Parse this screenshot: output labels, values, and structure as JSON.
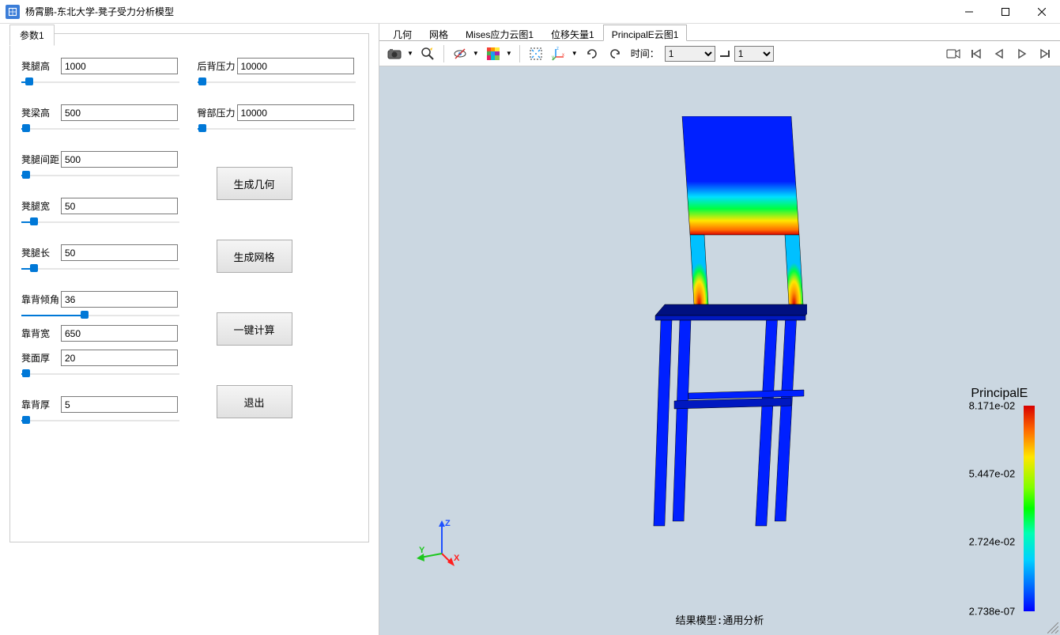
{
  "window": {
    "title": "杨霄鹏-东北大学-凳子受力分析模型"
  },
  "paramsTab": "参数1",
  "params": {
    "leg_height": {
      "label": "凳腿高",
      "value": "1000",
      "pct": 5
    },
    "beam_height": {
      "label": "凳梁高",
      "value": "500",
      "pct": 3
    },
    "leg_spacing": {
      "label": "凳腿间距",
      "value": "500",
      "pct": 3
    },
    "leg_width": {
      "label": "凳腿宽",
      "value": "50",
      "pct": 8
    },
    "leg_length": {
      "label": "凳腿长",
      "value": "50",
      "pct": 8
    },
    "back_angle": {
      "label": "靠背倾角",
      "value": "36",
      "pct": 40
    },
    "back_width": {
      "label": "靠背宽",
      "value": "650",
      "pct": 3
    },
    "seat_thick": {
      "label": "凳面厚",
      "value": "20",
      "pct": 3
    },
    "back_thick": {
      "label": "靠背厚",
      "value": "5",
      "pct": 3
    },
    "back_pressure": {
      "label": "后背压力",
      "value": "10000",
      "pct": 3
    },
    "hip_pressure": {
      "label": "臀部压力",
      "value": "10000",
      "pct": 3
    }
  },
  "buttons": {
    "gen_geom": "生成几何",
    "gen_mesh": "生成网格",
    "compute": "一键计算",
    "exit": "退出"
  },
  "viewTabs": [
    "几何",
    "网格",
    "Mises应力云图1",
    "位移矢量1",
    "PrincipalE云图1"
  ],
  "activeTab": 4,
  "toolbar": {
    "time_label": "时间：",
    "time_value": "1",
    "frame_value": "1"
  },
  "legend": {
    "title": "PrincipalE",
    "values": [
      "8.171e-02",
      "5.447e-02",
      "2.724e-02",
      "2.738e-07"
    ]
  },
  "resultLabel": "结果模型:通用分析",
  "axes": {
    "x": "X",
    "y": "Y",
    "z": "Z"
  }
}
